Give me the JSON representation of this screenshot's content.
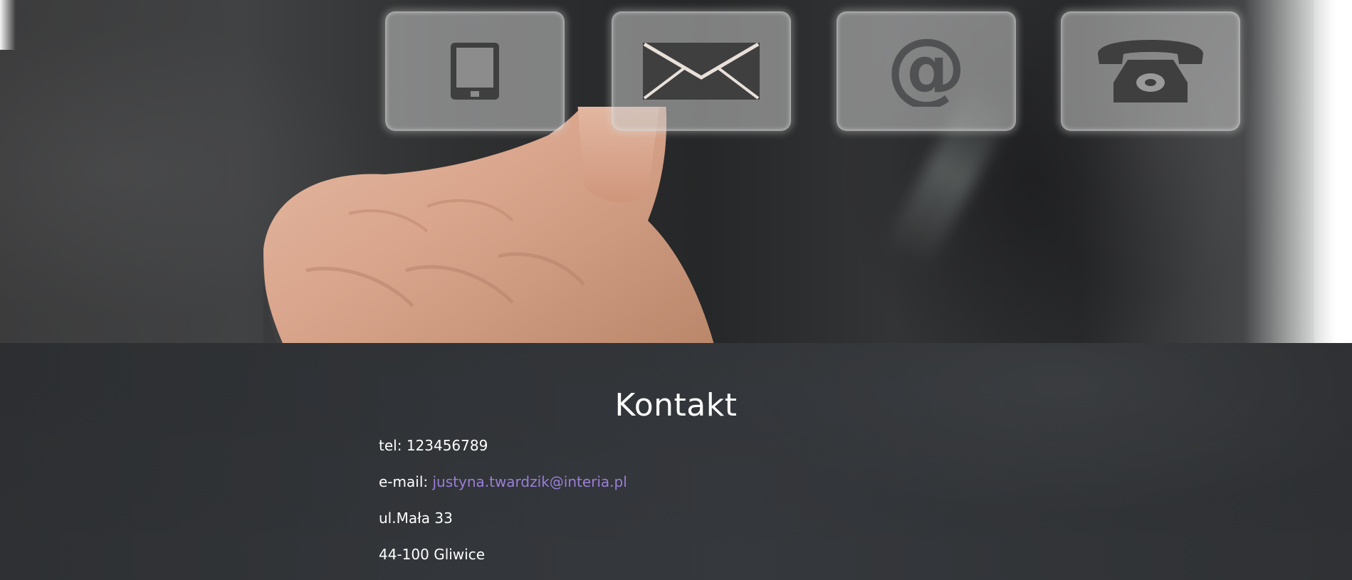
{
  "hero": {
    "icons": [
      {
        "name": "tablet-icon"
      },
      {
        "name": "envelope-icon"
      },
      {
        "name": "at-sign-icon",
        "glyph": "@"
      },
      {
        "name": "telephone-icon"
      }
    ]
  },
  "contact": {
    "title": "Kontakt",
    "tel_label": "tel:",
    "tel_value": "123456789",
    "email_label": "e-mail:",
    "email_value": "justyna.twardzik@interia.pl",
    "street": "ul.Mała 33",
    "city": "44-100 Gliwice"
  },
  "colors": {
    "section_bg": "#33363a",
    "text": "#ffffff",
    "link": "#9b7fd8",
    "icon": "#3f3f40"
  }
}
